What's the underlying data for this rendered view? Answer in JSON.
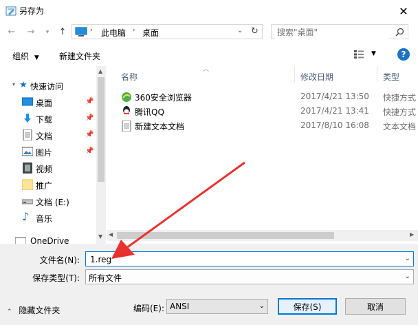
{
  "window": {
    "title": "另存为"
  },
  "address": {
    "path": [
      "此电脑",
      "桌面"
    ]
  },
  "search": {
    "placeholder": "搜索\"桌面\""
  },
  "toolbar": {
    "organize": "组织",
    "new_folder": "新建文件夹"
  },
  "nav": {
    "quick_access": "快速访问",
    "items": [
      {
        "label": "桌面",
        "icon": "desktop-icon",
        "pinned": true
      },
      {
        "label": "下载",
        "icon": "download-icon",
        "pinned": true
      },
      {
        "label": "文档",
        "icon": "document-icon",
        "pinned": true
      },
      {
        "label": "图片",
        "icon": "picture-icon",
        "pinned": true
      },
      {
        "label": "视频",
        "icon": "video-icon",
        "pinned": false
      },
      {
        "label": "推广",
        "icon": "folder-icon",
        "pinned": false
      },
      {
        "label": "文档 (E:)",
        "icon": "drive-icon",
        "pinned": false
      },
      {
        "label": "音乐",
        "icon": "music-icon",
        "pinned": false
      }
    ],
    "onedrive": "OneDrive"
  },
  "columns": {
    "name": "名称",
    "modified": "修改日期",
    "type": "类型"
  },
  "files": [
    {
      "name": "360安全浏览器",
      "date": "2017/4/21 13:50",
      "type": "快捷方式",
      "icon": "browser-360-icon"
    },
    {
      "name": "腾讯QQ",
      "date": "2017/4/21 13:41",
      "type": "快捷方式",
      "icon": "qq-icon"
    },
    {
      "name": "新建文本文档",
      "date": "2017/8/10 16:08",
      "type": "文本文档",
      "icon": "text-file-icon"
    }
  ],
  "form": {
    "filename_label": "文件名(N):",
    "filename_value": "1.reg",
    "savetype_label": "保存类型(T):",
    "savetype_value": "所有文件",
    "hide_folders": "隐藏文件夹",
    "encoding_label": "编码(E):",
    "encoding_value": "ANSI",
    "save": "保存(S)",
    "cancel": "取消"
  },
  "colors": {
    "accent": "#0078d7",
    "arrow": "#e8322f",
    "help": "#1e73be"
  }
}
